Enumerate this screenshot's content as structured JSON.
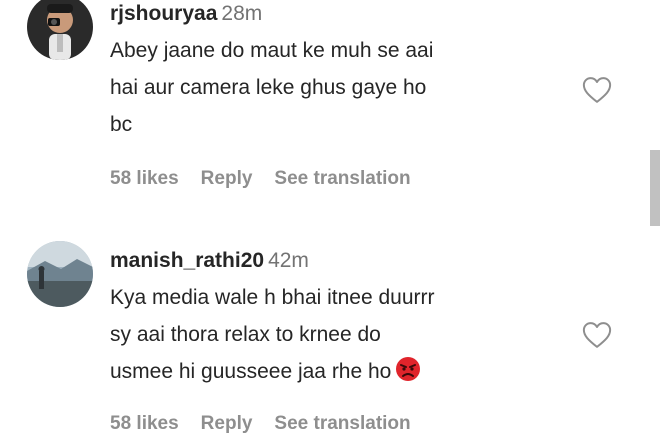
{
  "comments": [
    {
      "username": "rjshouryaa",
      "time": "28m",
      "text_lines": [
        "Abey jaane do maut ke muh se aai",
        "hai aur camera leke ghus gaye ho",
        "bc"
      ],
      "likes": "58 likes",
      "reply": "Reply",
      "translate": "See translation",
      "avatar_icon": "person-with-camera-avatar"
    },
    {
      "username": "manish_rathi20",
      "time": "42m",
      "text_lines": [
        "Kya media wale h bhai itnee duurrr",
        "sy aai thora relax to krnee do",
        "usmee hi guusseee jaa rhe ho"
      ],
      "emoji": "angry-face-emoji",
      "likes": "58 likes",
      "reply": "Reply",
      "translate": "See translation",
      "avatar_icon": "landscape-person-avatar"
    }
  ],
  "icons": {
    "like": "heart-outline-icon"
  },
  "colors": {
    "text": "#262626",
    "secondary": "#737373",
    "action": "#8e8e8e",
    "angry_emoji": "#e0242b"
  }
}
